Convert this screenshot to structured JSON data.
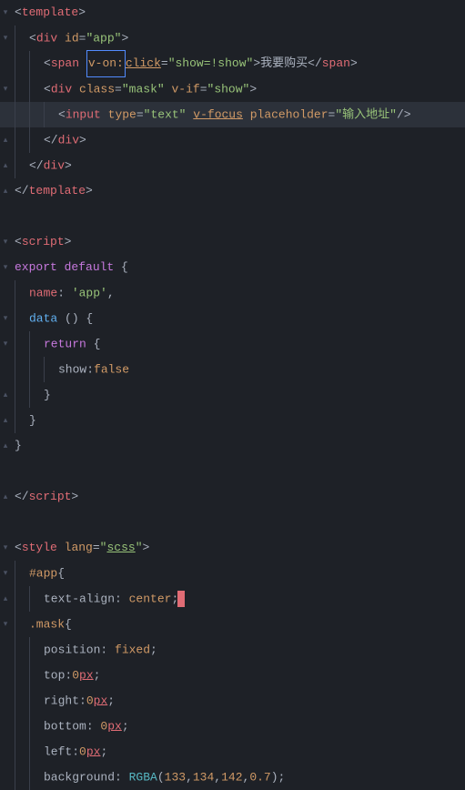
{
  "lines": [
    {
      "gutter": "▾",
      "indent": 0,
      "hl": false,
      "tokens": [
        {
          "t": "<",
          "c": "punc"
        },
        {
          "t": "template",
          "c": "tag"
        },
        {
          "t": ">",
          "c": "punc"
        }
      ]
    },
    {
      "gutter": "▾",
      "indent": 1,
      "hl": false,
      "tokens": [
        {
          "t": "<",
          "c": "punc"
        },
        {
          "t": "div",
          "c": "tag"
        },
        {
          "t": " ",
          "c": "punc"
        },
        {
          "t": "id",
          "c": "attr"
        },
        {
          "t": "=",
          "c": "punc"
        },
        {
          "t": "\"app\"",
          "c": "str"
        },
        {
          "t": ">",
          "c": "punc"
        }
      ]
    },
    {
      "gutter": "",
      "indent": 2,
      "hl": false,
      "tokens": [
        {
          "t": "<",
          "c": "punc"
        },
        {
          "t": "span",
          "c": "tag"
        },
        {
          "t": " ",
          "c": "punc"
        },
        {
          "t": "v-on:",
          "c": "attr",
          "box": true
        },
        {
          "t": "click",
          "c": "attr-u"
        },
        {
          "t": "=",
          "c": "punc"
        },
        {
          "t": "\"show=!show\"",
          "c": "str"
        },
        {
          "t": ">",
          "c": "punc"
        },
        {
          "t": "我要购买",
          "c": "text"
        },
        {
          "t": "</",
          "c": "punc"
        },
        {
          "t": "span",
          "c": "tag"
        },
        {
          "t": ">",
          "c": "punc"
        }
      ]
    },
    {
      "gutter": "▾",
      "indent": 2,
      "hl": false,
      "tokens": [
        {
          "t": "<",
          "c": "punc"
        },
        {
          "t": "div",
          "c": "tag"
        },
        {
          "t": " ",
          "c": "punc"
        },
        {
          "t": "class",
          "c": "attr"
        },
        {
          "t": "=",
          "c": "punc"
        },
        {
          "t": "\"mask\"",
          "c": "str"
        },
        {
          "t": " ",
          "c": "punc"
        },
        {
          "t": "v-if",
          "c": "attr"
        },
        {
          "t": "=",
          "c": "punc"
        },
        {
          "t": "\"show\"",
          "c": "str"
        },
        {
          "t": ">",
          "c": "punc"
        }
      ]
    },
    {
      "gutter": "",
      "indent": 3,
      "hl": true,
      "tokens": [
        {
          "t": "<",
          "c": "punc"
        },
        {
          "t": "input",
          "c": "tag"
        },
        {
          "t": " ",
          "c": "punc"
        },
        {
          "t": "type",
          "c": "attr"
        },
        {
          "t": "=",
          "c": "punc"
        },
        {
          "t": "\"text\"",
          "c": "str"
        },
        {
          "t": " ",
          "c": "punc"
        },
        {
          "t": "v-focus",
          "c": "attr-u"
        },
        {
          "t": " ",
          "c": "punc"
        },
        {
          "t": "placeholder",
          "c": "attr"
        },
        {
          "t": "=",
          "c": "punc"
        },
        {
          "t": "\"输入地址\"",
          "c": "str"
        },
        {
          "t": "/>",
          "c": "punc"
        }
      ]
    },
    {
      "gutter": "▴",
      "indent": 2,
      "hl": false,
      "tokens": [
        {
          "t": "</",
          "c": "punc"
        },
        {
          "t": "div",
          "c": "tag"
        },
        {
          "t": ">",
          "c": "punc"
        }
      ]
    },
    {
      "gutter": "▴",
      "indent": 1,
      "hl": false,
      "tokens": [
        {
          "t": "</",
          "c": "punc"
        },
        {
          "t": "div",
          "c": "tag"
        },
        {
          "t": ">",
          "c": "punc"
        }
      ]
    },
    {
      "gutter": "▴",
      "indent": 0,
      "hl": false,
      "tokens": [
        {
          "t": "</",
          "c": "punc"
        },
        {
          "t": "template",
          "c": "tag"
        },
        {
          "t": ">",
          "c": "punc"
        }
      ]
    },
    {
      "gutter": "",
      "indent": 0,
      "hl": false,
      "tokens": []
    },
    {
      "gutter": "▾",
      "indent": 0,
      "hl": false,
      "tokens": [
        {
          "t": "<",
          "c": "punc"
        },
        {
          "t": "script",
          "c": "tag"
        },
        {
          "t": ">",
          "c": "punc"
        }
      ]
    },
    {
      "gutter": "▾",
      "indent": 0,
      "hl": false,
      "tokens": [
        {
          "t": "export",
          "c": "kw"
        },
        {
          "t": " ",
          "c": "punc"
        },
        {
          "t": "default",
          "c": "kw"
        },
        {
          "t": " {",
          "c": "punc"
        }
      ]
    },
    {
      "gutter": "",
      "indent": 1,
      "hl": false,
      "tokens": [
        {
          "t": "name",
          "c": "prop"
        },
        {
          "t": ": ",
          "c": "punc"
        },
        {
          "t": "'app'",
          "c": "str"
        },
        {
          "t": ",",
          "c": "punc"
        }
      ]
    },
    {
      "gutter": "▾",
      "indent": 1,
      "hl": false,
      "tokens": [
        {
          "t": "data",
          "c": "func"
        },
        {
          "t": " () {",
          "c": "punc"
        }
      ]
    },
    {
      "gutter": "▾",
      "indent": 2,
      "hl": false,
      "tokens": [
        {
          "t": "return",
          "c": "kw"
        },
        {
          "t": " {",
          "c": "punc"
        }
      ]
    },
    {
      "gutter": "",
      "indent": 3,
      "hl": false,
      "tokens": [
        {
          "t": "show",
          "c": "ident"
        },
        {
          "t": ":",
          "c": "punc"
        },
        {
          "t": "false",
          "c": "val"
        }
      ]
    },
    {
      "gutter": "▴",
      "indent": 2,
      "hl": false,
      "tokens": [
        {
          "t": "}",
          "c": "punc"
        }
      ]
    },
    {
      "gutter": "▴",
      "indent": 1,
      "hl": false,
      "tokens": [
        {
          "t": "}",
          "c": "punc"
        }
      ]
    },
    {
      "gutter": "▴",
      "indent": 0,
      "hl": false,
      "tokens": [
        {
          "t": "}",
          "c": "punc"
        }
      ]
    },
    {
      "gutter": "",
      "indent": 0,
      "hl": false,
      "tokens": []
    },
    {
      "gutter": "▴",
      "indent": 0,
      "hl": false,
      "tokens": [
        {
          "t": "</",
          "c": "punc"
        },
        {
          "t": "script",
          "c": "tag"
        },
        {
          "t": ">",
          "c": "punc"
        }
      ]
    },
    {
      "gutter": "",
      "indent": 0,
      "hl": false,
      "tokens": []
    },
    {
      "gutter": "▾",
      "indent": 0,
      "hl": false,
      "tokens": [
        {
          "t": "<",
          "c": "punc"
        },
        {
          "t": "style",
          "c": "tag"
        },
        {
          "t": " ",
          "c": "punc"
        },
        {
          "t": "lang",
          "c": "attr"
        },
        {
          "t": "=",
          "c": "punc"
        },
        {
          "t": "\"",
          "c": "str"
        },
        {
          "t": "scss",
          "c": "scss-u"
        },
        {
          "t": "\"",
          "c": "str"
        },
        {
          "t": ">",
          "c": "punc"
        }
      ]
    },
    {
      "gutter": "▾",
      "indent": 1,
      "hl": false,
      "tokens": [
        {
          "t": "#app",
          "c": "attr"
        },
        {
          "t": "{",
          "c": "punc"
        }
      ]
    },
    {
      "gutter": "▴",
      "indent": 2,
      "hl": false,
      "tokens": [
        {
          "t": "text-align",
          "c": "ident"
        },
        {
          "t": ": ",
          "c": "punc"
        },
        {
          "t": "center",
          "c": "attr"
        },
        {
          "t": ";",
          "c": "punc"
        },
        {
          "t": "",
          "c": "punc",
          "cursor": true
        }
      ]
    },
    {
      "gutter": "▾",
      "indent": 1,
      "hl": false,
      "tokens": [
        {
          "t": ".mask",
          "c": "attr"
        },
        {
          "t": "{",
          "c": "punc"
        }
      ]
    },
    {
      "gutter": "",
      "indent": 2,
      "hl": false,
      "tokens": [
        {
          "t": "position",
          "c": "ident"
        },
        {
          "t": ": ",
          "c": "punc"
        },
        {
          "t": "fixed",
          "c": "attr"
        },
        {
          "t": ";",
          "c": "punc"
        }
      ]
    },
    {
      "gutter": "",
      "indent": 2,
      "hl": false,
      "tokens": [
        {
          "t": "top",
          "c": "ident"
        },
        {
          "t": ":",
          "c": "punc"
        },
        {
          "t": "0",
          "c": "num"
        },
        {
          "t": "px",
          "c": "unit"
        },
        {
          "t": ";",
          "c": "punc"
        }
      ]
    },
    {
      "gutter": "",
      "indent": 2,
      "hl": false,
      "tokens": [
        {
          "t": "right",
          "c": "ident"
        },
        {
          "t": ":",
          "c": "punc"
        },
        {
          "t": "0",
          "c": "num"
        },
        {
          "t": "px",
          "c": "unit"
        },
        {
          "t": ";",
          "c": "punc"
        }
      ]
    },
    {
      "gutter": "",
      "indent": 2,
      "hl": false,
      "tokens": [
        {
          "t": "bottom",
          "c": "ident"
        },
        {
          "t": ": ",
          "c": "punc"
        },
        {
          "t": "0",
          "c": "num"
        },
        {
          "t": "px",
          "c": "unit"
        },
        {
          "t": ";",
          "c": "punc"
        }
      ]
    },
    {
      "gutter": "",
      "indent": 2,
      "hl": false,
      "tokens": [
        {
          "t": "left",
          "c": "ident"
        },
        {
          "t": ":",
          "c": "punc"
        },
        {
          "t": "0",
          "c": "num"
        },
        {
          "t": "px",
          "c": "unit"
        },
        {
          "t": ";",
          "c": "punc"
        }
      ]
    },
    {
      "gutter": "",
      "indent": 2,
      "hl": false,
      "tokens": [
        {
          "t": "background",
          "c": "ident"
        },
        {
          "t": ": ",
          "c": "punc"
        },
        {
          "t": "RGBA",
          "c": "rgba"
        },
        {
          "t": "(",
          "c": "punc"
        },
        {
          "t": "133",
          "c": "num"
        },
        {
          "t": ",",
          "c": "punc"
        },
        {
          "t": "134",
          "c": "num"
        },
        {
          "t": ",",
          "c": "punc"
        },
        {
          "t": "142",
          "c": "num"
        },
        {
          "t": ",",
          "c": "punc"
        },
        {
          "t": "0.7",
          "c": "num"
        },
        {
          "t": ");",
          "c": "punc"
        }
      ]
    }
  ]
}
